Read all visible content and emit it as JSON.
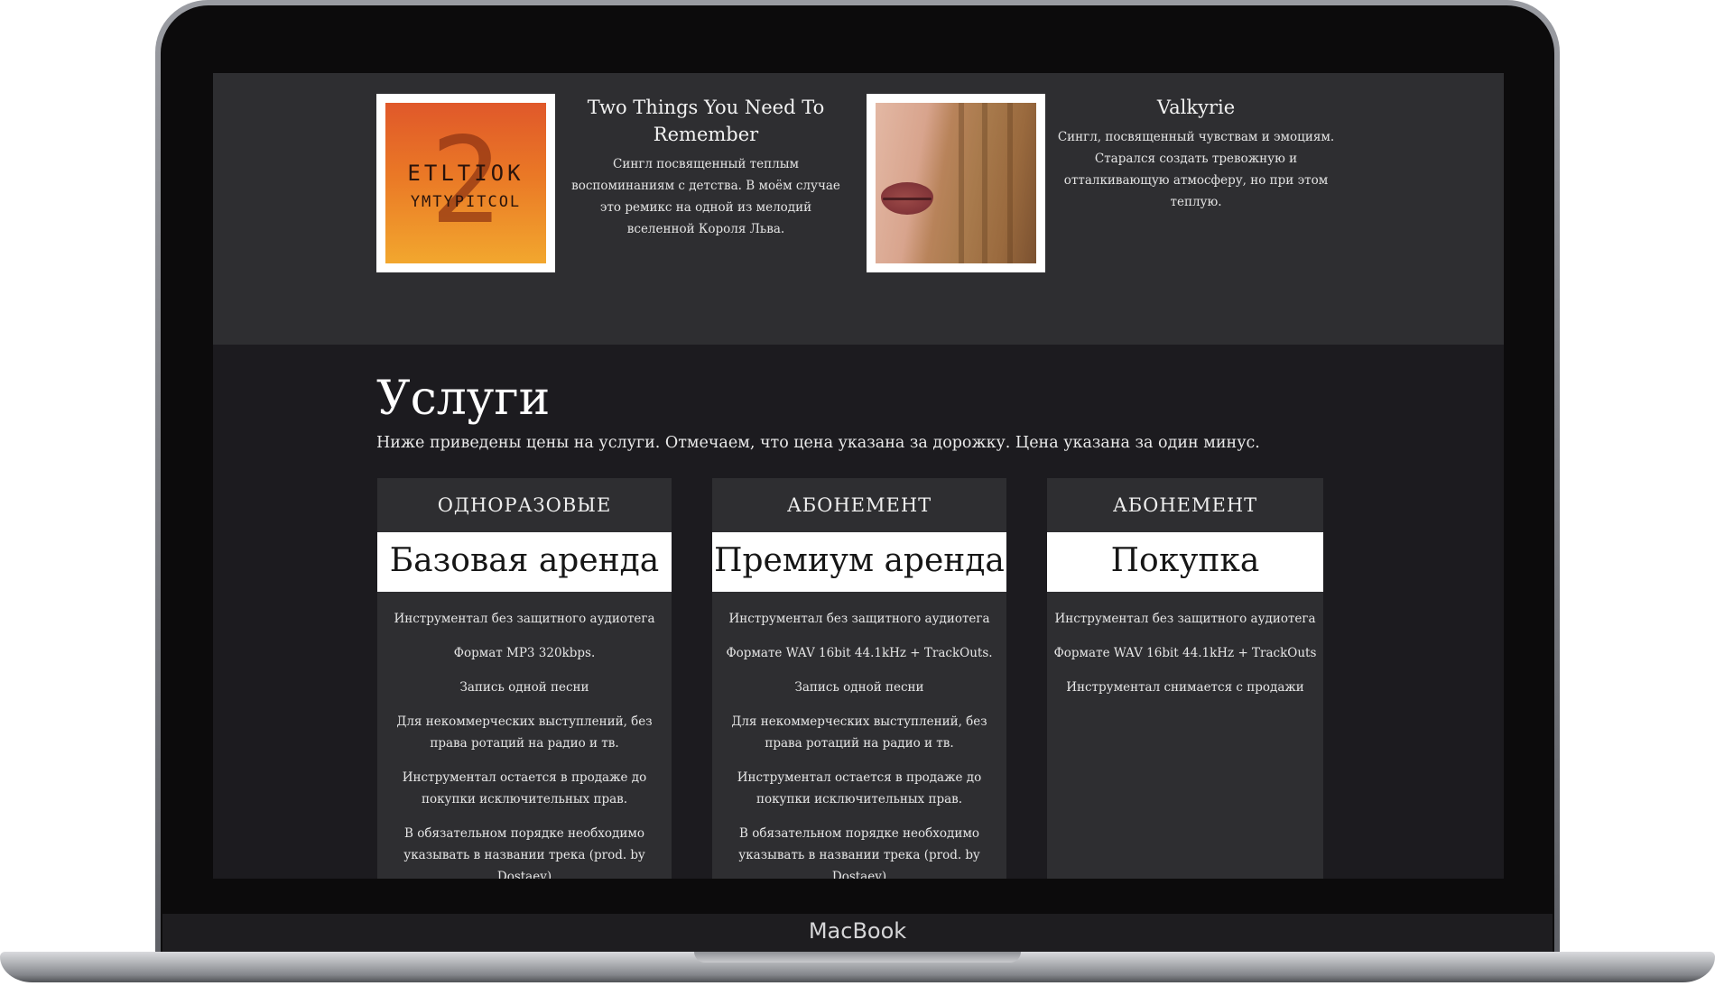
{
  "device": {
    "brand": "MacBook"
  },
  "releases": [
    {
      "title": "Two Things You Need To Remember",
      "description": "Сингл посвященный теплым воспоминаниям с детства. В моём случае это ремикс на одной из мелодий вселенной Короля Льва.",
      "cover": {
        "digit": "2",
        "line1": "ETLTIOK",
        "line2": "YMTYPITCOL"
      }
    },
    {
      "title": "Valkyrie",
      "description": "Сингл, посвященный чувствам и эмоциям. Старался создать тревожную и отталкивающую атмосферу, но при этом теплую."
    }
  ],
  "services": {
    "title": "Услуги",
    "intro": "Ниже приведены цены на услуги. Отмечаем, что цена указана за дорожку. Цена указана за один минус.",
    "plans": [
      {
        "type": "ОДНОРАЗОВЫЕ",
        "name": "Базовая аренда",
        "features": [
          "Инструментал без защитного аудиотега",
          "Формат MP3 320kbps.",
          "Запись одной песни",
          "Для некоммерческих выступлений, без права ротаций на радио и тв.",
          "Инструментал остается в продаже до покупки исключительных прав.",
          "В обязательном порядке необходимо указывать в названии трека (prod. by Dostaev)"
        ]
      },
      {
        "type": "АБОНЕМЕНТ",
        "name": "Премиум аренда",
        "features": [
          "Инструментал без защитного аудиотега",
          "Формате WAV 16bit 44.1kHz + TrackOuts.",
          "Запись одной песни",
          "Для некоммерческих выступлений, без права ротаций на радио и тв.",
          "Инструментал остается в продаже до покупки исключительных прав.",
          "В обязательном порядке необходимо указывать в названии трека (prod. by Dostaev)"
        ]
      },
      {
        "type": "АБОНЕМЕНТ",
        "name": "Покупка",
        "features": [
          "Инструментал без защитного аудиотега",
          "Формате WAV 16bit 44.1kHz + TrackOuts",
          "Инструментал снимается с продажи"
        ]
      }
    ]
  }
}
